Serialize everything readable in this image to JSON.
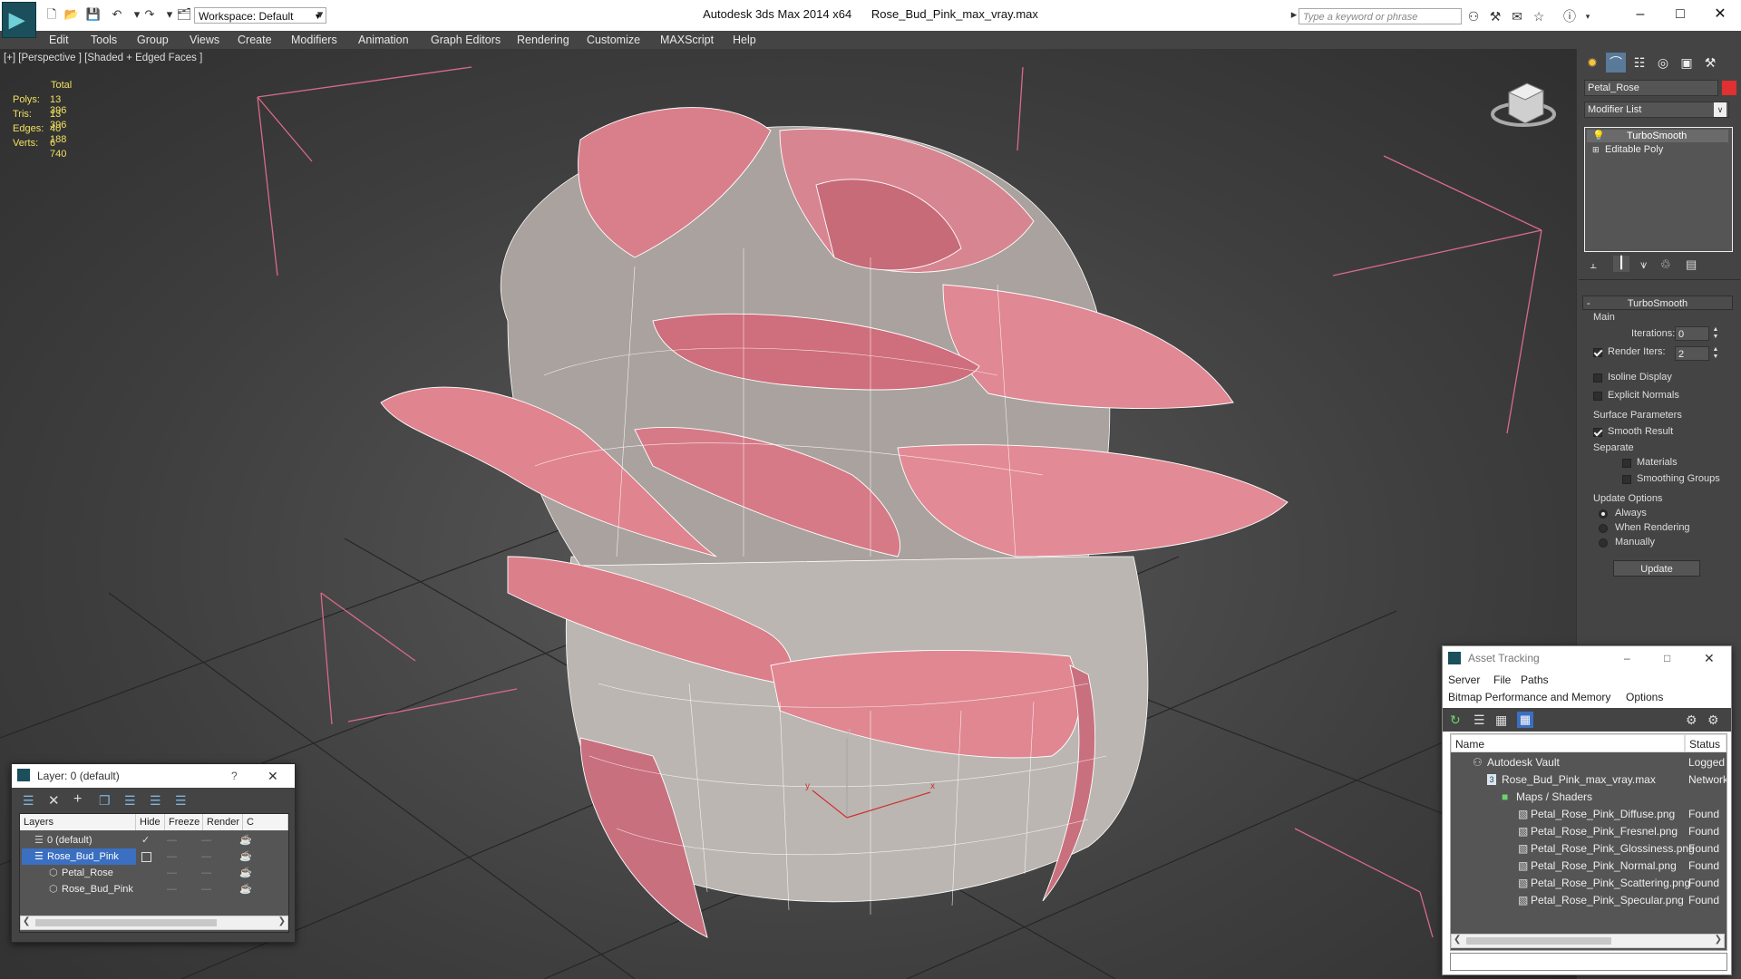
{
  "app": {
    "title": "Autodesk 3ds Max  2014 x64",
    "filename": "Rose_Bud_Pink_max_vray.max",
    "workspace": "Workspace: Default",
    "search_placeholder": "Type a keyword or phrase",
    "accent": "#1b4f5c"
  },
  "menu": [
    "Edit",
    "Tools",
    "Group",
    "Views",
    "Create",
    "Modifiers",
    "Animation",
    "Graph Editors",
    "Rendering",
    "Customize",
    "MAXScript",
    "Help"
  ],
  "viewport": {
    "label": "[+] [Perspective ] [Shaded + Edged Faces ]",
    "stats": {
      "header": "Total",
      "rows": [
        {
          "label": "Polys:",
          "value": "13 396"
        },
        {
          "label": "Tris:",
          "value": "13 396"
        },
        {
          "label": "Edges:",
          "value": "40 188"
        },
        {
          "label": "Verts:",
          "value": "6 740"
        }
      ]
    },
    "axes": {
      "x": "x",
      "y": "y",
      "z": "z"
    }
  },
  "command_panel": {
    "object_name": "Petal_Rose",
    "object_color": "#e03030",
    "modifier_list": "Modifier List",
    "stack": [
      "TurboSmooth",
      "Editable Poly"
    ],
    "rollout_title": "TurboSmooth",
    "main_label": "Main",
    "iterations_label": "Iterations:",
    "iterations_value": "0",
    "render_iters_label": "Render Iters:",
    "render_iters_value": "2",
    "render_iters_checked": true,
    "isoline_label": "Isoline Display",
    "explicit_normals_label": "Explicit Normals",
    "surface_label": "Surface Parameters",
    "smooth_result_label": "Smooth Result",
    "separate_label": "Separate",
    "materials_label": "Materials",
    "smoothing_groups_label": "Smoothing Groups",
    "update_options_label": "Update Options",
    "always_label": "Always",
    "when_rendering_label": "When Rendering",
    "manually_label": "Manually",
    "update_button": "Update"
  },
  "layer_dialog": {
    "title": "Layer: 0 (default)",
    "help": "?",
    "columns": [
      "Layers",
      "Hide",
      "Freeze",
      "Render",
      "C"
    ],
    "rows": [
      {
        "name": "0 (default)",
        "indent": 0,
        "selected": false
      },
      {
        "name": "Rose_Bud_Pink",
        "indent": 0,
        "selected": true
      },
      {
        "name": "Petal_Rose",
        "indent": 1,
        "selected": false
      },
      {
        "name": "Rose_Bud_Pink",
        "indent": 1,
        "selected": false
      }
    ]
  },
  "asset_tracking": {
    "title": "Asset Tracking",
    "menu_row1": [
      "Server",
      "File",
      "Paths"
    ],
    "menu_row2": [
      "Bitmap Performance and Memory",
      "Options"
    ],
    "columns": [
      "Name",
      "Status"
    ],
    "rows": [
      {
        "name": "Autodesk Vault",
        "status": "Logged O",
        "indent": 1
      },
      {
        "name": "Rose_Bud_Pink_max_vray.max",
        "status": "Network",
        "indent": 2
      },
      {
        "name": "Maps / Shaders",
        "status": "",
        "indent": 3
      },
      {
        "name": "Petal_Rose_Pink_Diffuse.png",
        "status": "Found",
        "indent": 4
      },
      {
        "name": "Petal_Rose_Pink_Fresnel.png",
        "status": "Found",
        "indent": 4
      },
      {
        "name": "Petal_Rose_Pink_Glossiness.png",
        "status": "Found",
        "indent": 4
      },
      {
        "name": "Petal_Rose_Pink_Normal.png",
        "status": "Found",
        "indent": 4
      },
      {
        "name": "Petal_Rose_Pink_Scattering.png",
        "status": "Found",
        "indent": 4
      },
      {
        "name": "Petal_Rose_Pink_Specular.png",
        "status": "Found",
        "indent": 4
      }
    ]
  }
}
